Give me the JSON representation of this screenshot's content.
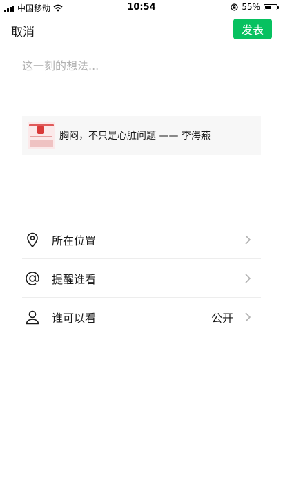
{
  "status_bar": {
    "carrier": "中国移动",
    "time": "10:54",
    "battery_percent": "55%",
    "battery_level": 0.55
  },
  "nav": {
    "cancel_label": "取消",
    "publish_label": "发表",
    "accent_color": "#07c160"
  },
  "composer": {
    "placeholder": "这一刻的想法..."
  },
  "shared_link": {
    "title": "胸闷，不只是心脏问题 —— 李海燕"
  },
  "options": [
    {
      "label": "所在位置",
      "icon": "location-pin-icon",
      "value": ""
    },
    {
      "label": "提醒谁看",
      "icon": "at-sign-icon",
      "value": ""
    },
    {
      "label": "谁可以看",
      "icon": "person-icon",
      "value": "公开"
    }
  ]
}
